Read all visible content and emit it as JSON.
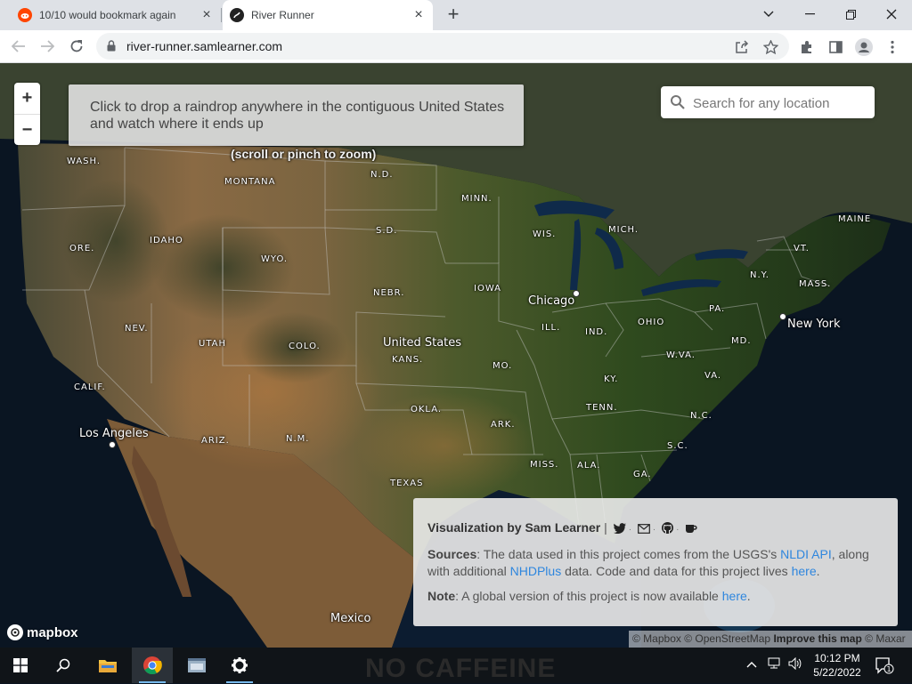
{
  "browser": {
    "tabs": [
      {
        "title": "10/10 would bookmark again",
        "favicon": "reddit-icon"
      },
      {
        "title": "River Runner",
        "favicon": "river-runner-icon",
        "active": true
      }
    ],
    "url": "river-runner.samlearner.com"
  },
  "map": {
    "zoom_in": "+",
    "zoom_out": "−",
    "instruction": "Click to drop a raindrop anywhere in the contiguous United States and watch where it ends up",
    "zoom_hint": "(scroll or pinch to zoom)",
    "search_placeholder": "Search for any location",
    "states": [
      "WASH.",
      "MONTANA",
      "N.D.",
      "MINN.",
      "ORE.",
      "IDAHO",
      "S.D.",
      "WYO.",
      "WIS.",
      "MICH.",
      "MAINE",
      "VT.",
      "N.Y.",
      "MASS.",
      "NEBR.",
      "IOWA",
      "PA.",
      "NEV.",
      "UTAH",
      "COLO.",
      "ILL.",
      "IND.",
      "OHIO",
      "MD.",
      "KANS.",
      "W.VA.",
      "VA.",
      "MO.",
      "KY.",
      "CALIF.",
      "OKLA.",
      "TENN.",
      "N.C.",
      "ARK.",
      "ARIZ.",
      "N.M.",
      "S.C.",
      "MISS.",
      "ALA.",
      "GA.",
      "TEXAS"
    ],
    "cities": [
      "Chicago",
      "New York",
      "Los Angeles"
    ],
    "countries": [
      "United States",
      "Mexico"
    ],
    "attribution": {
      "mapbox": "© Mapbox",
      "osm": "© OpenStreetMap",
      "improve": "Improve this map",
      "maxar": "© Maxar"
    },
    "logo": "mapbox"
  },
  "info": {
    "byline_prefix": "Visualization by",
    "author": "Sam Learner",
    "sources_label": "Sources",
    "sources_text1": ": The data used in this project comes from the USGS's ",
    "nldi": "NLDI API",
    "sources_text2": ", along with additional ",
    "nhdplus": "NHDPlus",
    "sources_text3": " data. Code and data for this project lives ",
    "here1": "here",
    "note_label": "Note",
    "note_text": ": A global version of this project is now available ",
    "here2": "here"
  },
  "taskbar": {
    "time": "10:12 PM",
    "date": "5/22/2022",
    "background_text": "NO CAFFEINE",
    "notification_count": "1"
  }
}
